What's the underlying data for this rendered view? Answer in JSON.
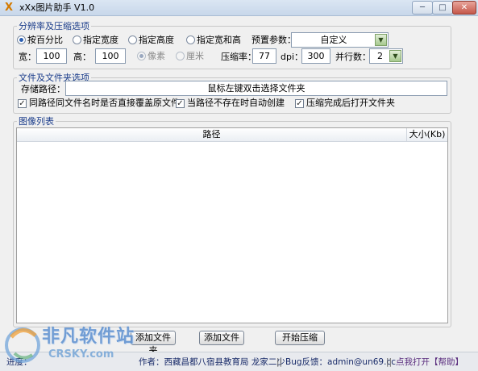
{
  "window": {
    "title": "xXx图片助手 V1.0",
    "icon_glyph": "X",
    "controls": {
      "minimize": "─",
      "maximize": "□",
      "close": "✕"
    }
  },
  "resolution_group": {
    "legend": "分辨率及压缩选项",
    "modes": [
      {
        "label": "按百分比",
        "checked": true
      },
      {
        "label": "指定宽度",
        "checked": false
      },
      {
        "label": "指定高度",
        "checked": false
      },
      {
        "label": "指定宽和高",
        "checked": false
      }
    ],
    "preset_label": "预置参数：",
    "preset_value": "自定义",
    "width_label": "宽：",
    "width_value": "100",
    "height_label": "高：",
    "height_value": "100",
    "units": [
      {
        "label": "像素",
        "checked": true,
        "disabled": true
      },
      {
        "label": "厘米",
        "checked": false,
        "disabled": true
      }
    ],
    "compression_label": "压缩率：",
    "compression_value": "77",
    "dpi_label": "dpi：",
    "dpi_value": "300",
    "threads_label": "并行数：",
    "threads_value": "2"
  },
  "folder_group": {
    "legend": "文件及文件夹选项",
    "save_path_label": "存储路径：",
    "save_path_value": "鼠标左键双击选择文件夹",
    "options": [
      {
        "label": "同路径同文件名时是否直接覆盖原文件",
        "checked": true
      },
      {
        "label": "当路径不存在时自动创建",
        "checked": true
      },
      {
        "label": "压缩完成后打开文件夹",
        "checked": true
      }
    ]
  },
  "image_list": {
    "legend": "图像列表",
    "columns": {
      "path": "路径",
      "size": "大小(Kb)"
    },
    "rows": []
  },
  "actions": {
    "add_folder": "添加文件夹",
    "add_file": "添加文件",
    "start": "开始压缩"
  },
  "status": {
    "progress_label": "进度：",
    "author": "作者：西藏昌都八宿县教育局 龙家二少",
    "separator": "||",
    "bug_report": "Bug反馈：admin@un69.cc",
    "help": "点我打开【帮助】"
  },
  "watermark": {
    "cn": "非凡软件站",
    "en": "CRSKY.com"
  }
}
